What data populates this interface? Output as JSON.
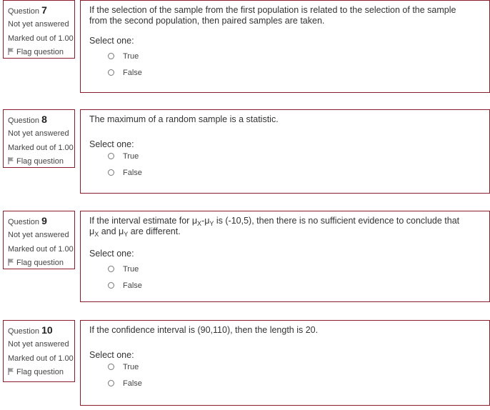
{
  "questions": [
    {
      "label": "Question ",
      "number": "7",
      "state": "Not yet answered",
      "grade": "Marked out of 1.00",
      "flag_label": "Flag question",
      "text": "If the selection of the sample from the first population is related to the selection of the sample from the second population, then paired samples are taken.",
      "prompt": "Select one:",
      "options": [
        "True",
        "False"
      ]
    },
    {
      "label": "Question ",
      "number": "8",
      "state": "Not yet answered",
      "grade": "Marked out of 1.00",
      "flag_label": "Flag question",
      "text": "The maximum of a random sample is a statistic.",
      "prompt": "Select one:",
      "options": [
        "True",
        "False"
      ]
    },
    {
      "label": "Question ",
      "number": "9",
      "state": "Not yet answered",
      "grade": "Marked out of 1.00",
      "flag_label": "Flag question",
      "text_parts": {
        "p1": "If the interval estimate for ",
        "mu": "μ",
        "subX": "X",
        "dash": "-",
        "subY": "Y",
        "p2": " is (-10,5), then there is no sufficient evidence to conclude that ",
        "p3": " and ",
        "p4": " are different."
      },
      "prompt": "Select one:",
      "options": [
        "True",
        "False"
      ]
    },
    {
      "label": "Question ",
      "number": "10",
      "state": "Not yet answered",
      "grade": "Marked out of 1.00",
      "flag_label": "Flag question",
      "text": "If the confidence interval is (90,110), then the length is 20.",
      "prompt": "Select one:",
      "options": [
        "True",
        "False"
      ]
    }
  ]
}
